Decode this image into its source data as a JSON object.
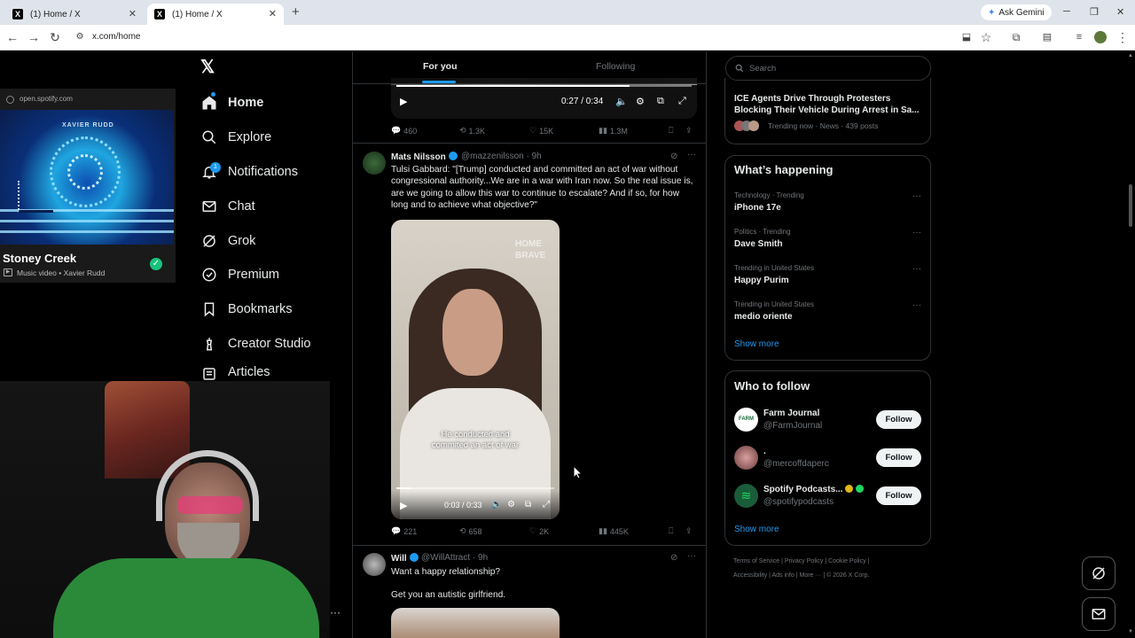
{
  "browser": {
    "tabs": [
      {
        "title": "(1) Home / X"
      },
      {
        "title": "(1) Home / X"
      }
    ],
    "new_tab": "+",
    "url": "x.com/home",
    "ask_gemini": "Ask Gemini"
  },
  "spotify_mini": {
    "source": "open.spotify.com",
    "album_text": "XAVIER RUDD",
    "title": "Stoney Creek",
    "subtitle": "Music video • Xavier Rudd"
  },
  "sidebar": {
    "logo": "𝕏",
    "items": [
      {
        "label": "Home",
        "icon": "home-icon"
      },
      {
        "label": "Explore",
        "icon": "search-icon"
      },
      {
        "label": "Notifications",
        "icon": "bell-icon",
        "badge": "1"
      },
      {
        "label": "Chat",
        "icon": "mail-icon"
      },
      {
        "label": "Grok",
        "icon": "grok-icon"
      },
      {
        "label": "Premium",
        "icon": "premium-icon"
      },
      {
        "label": "Bookmarks",
        "icon": "bookmark-icon"
      },
      {
        "label": "Creator Studio",
        "icon": "creator-icon"
      },
      {
        "label": "Articles",
        "icon": "articles-icon"
      }
    ],
    "more": "···"
  },
  "feed": {
    "tabs": {
      "for_you": "For you",
      "following": "Following"
    },
    "prev_post": {
      "video_time": "0:27 / 0:34",
      "progress": 0.79,
      "replies": "460",
      "reposts": "1.3K",
      "likes": "15K",
      "views": "1.3M"
    },
    "post1": {
      "name": "Mats Nilsson",
      "handle": "@mazzenilsson · 9h",
      "text": "Tulsi Gabbard: \"[Trump] conducted and committed an act of war without congressional authority...We are in a war with Iran now. So the real issue is, are we going to allow this war to continue to escalate? And if so, for how long and to achieve what objective?\"",
      "video_watermark": "HOME\nBRAVE",
      "video_caption": "He conducted and\ncommited an act of war",
      "video_time": "0:03 / 0:33",
      "progress": 0.09,
      "replies": "221",
      "reposts": "658",
      "likes": "2K",
      "views": "445K"
    },
    "post2": {
      "name": "Will",
      "handle": "@WillAttract · 9h",
      "line1": "Want a happy relationship?",
      "line2": "Get you an autistic girlfriend."
    }
  },
  "right": {
    "search_placeholder": "Search",
    "news": {
      "title": "ICE Agents Drive Through Protesters Blocking Their Vehicle During Arrest in Sa...",
      "meta": "Trending now · News · 439 posts"
    },
    "whats_happening": {
      "heading": "What’s happening",
      "trends": [
        {
          "meta": "Technology · Trending",
          "name": "iPhone 17e"
        },
        {
          "meta": "Politics · Trending",
          "name": "Dave Smith"
        },
        {
          "meta": "Trending in United States",
          "name": "Happy Purim"
        },
        {
          "meta": "Trending in United States",
          "name": "medio oriente"
        }
      ],
      "show_more": "Show more"
    },
    "who_to_follow": {
      "heading": "Who to follow",
      "accounts": [
        {
          "name": "Farm Journal",
          "handle": "@FarmJournal"
        },
        {
          "name": ".",
          "handle": "@mercoffdaperc"
        },
        {
          "name": "Spotify Podcasts...",
          "handle": "@spotifypodcasts"
        }
      ],
      "follow_label": "Follow",
      "show_more": "Show more"
    },
    "footer": {
      "line1": [
        "Terms of Service",
        "Privacy Policy",
        "Cookie Policy"
      ],
      "line2": [
        "Accessibility",
        "Ads info",
        "More ···",
        "© 2026 X Corp."
      ]
    }
  },
  "colors": {
    "accent": "#1d9bf0",
    "background": "#000000",
    "border": "#2f3336",
    "muted": "#71767b"
  }
}
